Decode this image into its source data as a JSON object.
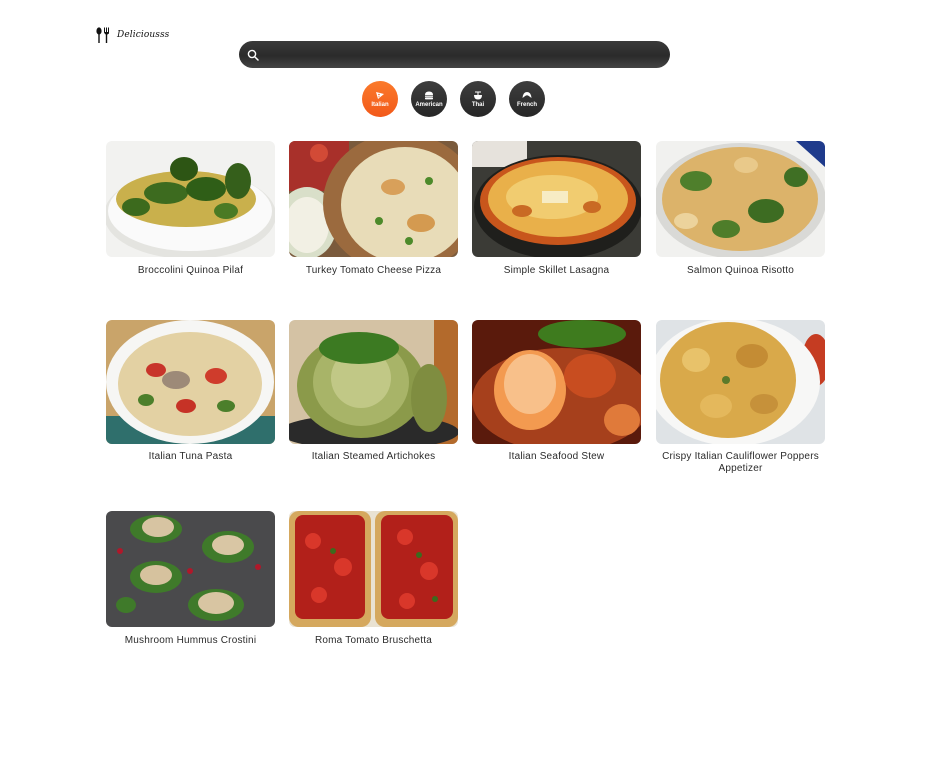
{
  "brand": {
    "name": "Deliciousss",
    "icon": "fork-spoon-icon"
  },
  "search": {
    "value": "",
    "placeholder": "",
    "icon": "search-icon"
  },
  "categories": [
    {
      "label": "Italian",
      "icon": "pizza-icon",
      "active": true
    },
    {
      "label": "American",
      "icon": "burger-icon",
      "active": false
    },
    {
      "label": "Thai",
      "icon": "noodle-bowl-icon",
      "active": false
    },
    {
      "label": "French",
      "icon": "croissant-icon",
      "active": false
    }
  ],
  "colors": {
    "accent": "#f4621e",
    "chip": "#333333",
    "search_bg": "#333333"
  },
  "recipes": [
    {
      "title": "Broccolini Quinoa Pilaf"
    },
    {
      "title": "Turkey Tomato Cheese Pizza"
    },
    {
      "title": "Simple Skillet Lasagna"
    },
    {
      "title": "Salmon Quinoa Risotto"
    },
    {
      "title": "Italian Tuna Pasta"
    },
    {
      "title": "Italian Steamed Artichokes"
    },
    {
      "title": "Italian Seafood Stew"
    },
    {
      "title": "Crispy Italian Cauliflower Poppers Appetizer"
    },
    {
      "title": "Mushroom Hummus Crostini"
    },
    {
      "title": "Roma Tomato Bruschetta"
    }
  ]
}
